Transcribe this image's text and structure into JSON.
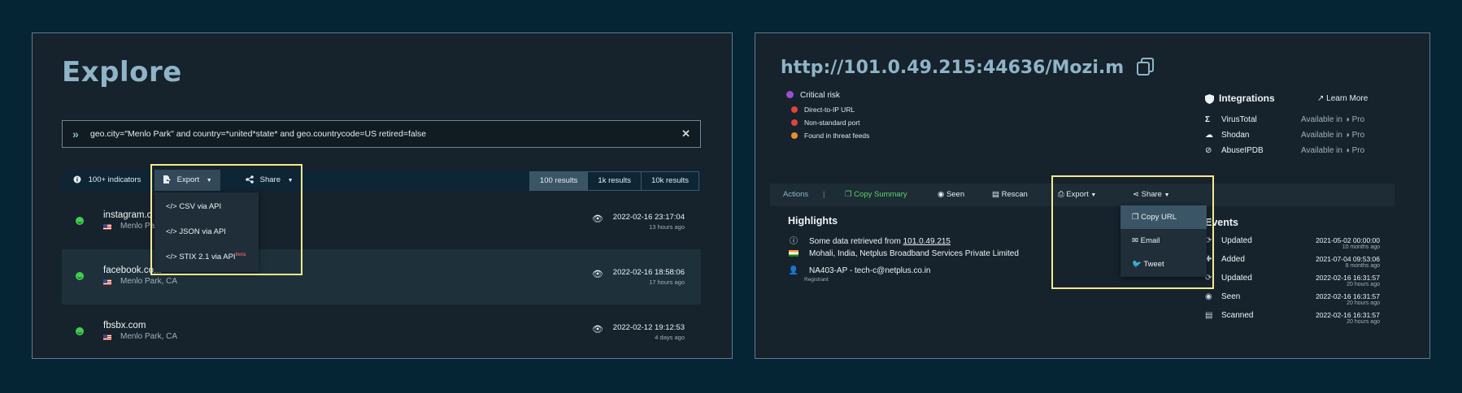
{
  "explore": {
    "title": "Explore",
    "query": "geo.city=\"Menlo Park\" and country=*united*state* and geo.countrycode=US retired=false",
    "toolbar": {
      "indicators": "100+ indicators",
      "export": "Export",
      "share": "Share",
      "results": [
        "100 results",
        "1k results",
        "10k results"
      ]
    },
    "export_menu": [
      "CSV via API",
      "JSON via API",
      "STIX 2.1 via API"
    ],
    "beta_label": "beta",
    "rows": [
      {
        "domain": "instagram.c",
        "location": "Menlo Pa",
        "timestamp": "2022-02-16 23:17:04",
        "ago": "13 hours ago"
      },
      {
        "domain": "facebook.co...",
        "location": "Menlo Park, CA",
        "timestamp": "2022-02-16 18:58:06",
        "ago": "17 hours ago"
      },
      {
        "domain": "fbsbx.com",
        "location": "Menlo Park, CA",
        "timestamp": "2022-02-12 19:12:53",
        "ago": "4 days ago"
      }
    ]
  },
  "detail": {
    "url": "http://101.0.49.215:44636/Mozi.m",
    "risk": "Critical risk",
    "flags": [
      {
        "label": "Direct-to-IP URL",
        "color": "#e0443a"
      },
      {
        "label": "Non-standard port",
        "color": "#e0443a"
      },
      {
        "label": "Found in threat feeds",
        "color": "#e8902a"
      }
    ],
    "integrations": {
      "title": "Integrations",
      "learn_more": "Learn More",
      "items": [
        {
          "name": "VirusTotal",
          "availability": "Available in",
          "tier": "Pro"
        },
        {
          "name": "Shodan",
          "availability": "Available in",
          "tier": "Pro"
        },
        {
          "name": "AbuseIPDB",
          "availability": "Available in",
          "tier": "Pro"
        }
      ]
    },
    "actions": {
      "label": "Actions",
      "copy_summary": "Copy Summary",
      "seen": "Seen",
      "rescan": "Rescan",
      "export": "Export",
      "share": "Share"
    },
    "share_menu": [
      "Copy URL",
      "Email",
      "Tweet"
    ],
    "highlights": {
      "title": "Highlights",
      "data_prefix": "Some data retrieved from",
      "data_link": "101.0.49.215",
      "location": "Mohali, India, Netplus Broadband Services Private Limited",
      "registrant": "NA403-AP - tech-c@netplus.co.in",
      "registrant_label": "Registrant"
    },
    "events": {
      "title": "Events",
      "items": [
        {
          "label": "Updated",
          "time": "2021-05-02 00:00:00",
          "ago": "10 months ago",
          "icon": "refresh-icon"
        },
        {
          "label": "Added",
          "time": "2021-07-04 09:53:06",
          "ago": "8 months ago",
          "icon": "plus-icon"
        },
        {
          "label": "Updated",
          "time": "2022-02-16 16:31:57",
          "ago": "20 hours ago",
          "icon": "refresh-icon"
        },
        {
          "label": "Seen",
          "time": "2022-02-16 16:31:57",
          "ago": "20 hours ago",
          "icon": "eye-icon"
        },
        {
          "label": "Scanned",
          "time": "2022-02-16 16:31:57",
          "ago": "20 hours ago",
          "icon": "scan-icon"
        }
      ]
    }
  },
  "colors": {
    "background": "#052535",
    "panel": "#16232c",
    "accent": "#8fb4c8",
    "highlight_box": "#f5e98e",
    "safe": "#3fcf4f",
    "critical": "#9b4fd0",
    "copy_summary": "#5dd36a"
  }
}
